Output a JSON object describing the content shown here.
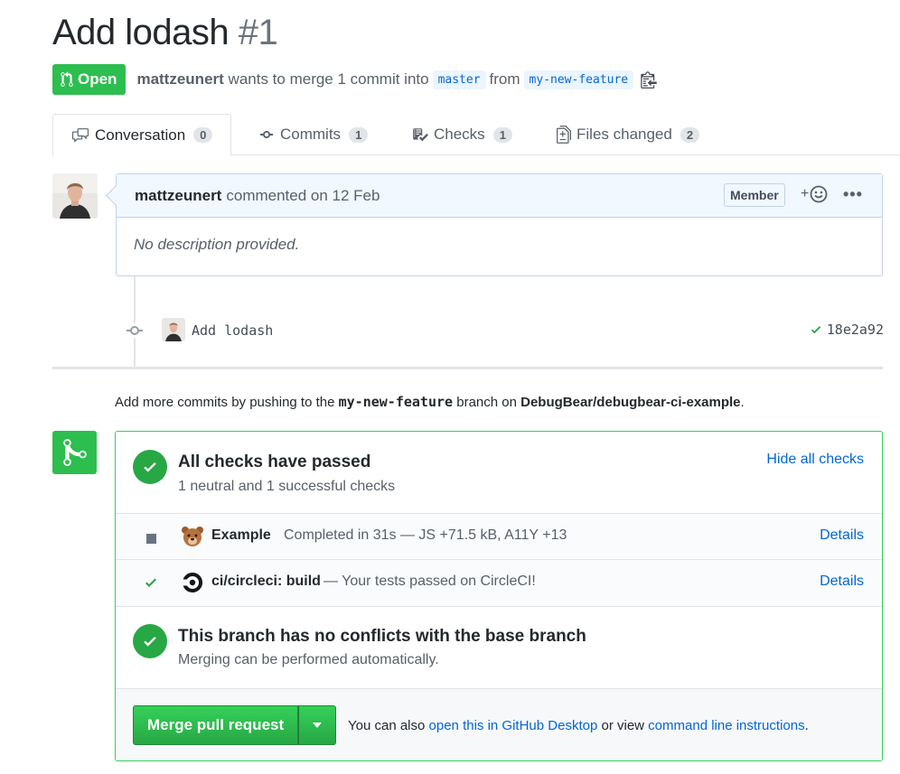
{
  "pr": {
    "title": "Add lodash",
    "number": "#1",
    "state": "Open",
    "author": "mattzeunert",
    "merge_text": "wants to merge 1 commit into",
    "base_branch": "master",
    "from_text": "from",
    "head_branch": "my-new-feature"
  },
  "tabs": [
    {
      "label": "Conversation",
      "count": "0",
      "icon": "comment-discussion-icon",
      "active": true
    },
    {
      "label": "Commits",
      "count": "1",
      "icon": "git-commit-icon"
    },
    {
      "label": "Checks",
      "count": "1",
      "icon": "checklist-icon"
    },
    {
      "label": "Files changed",
      "count": "2",
      "icon": "file-diff-icon"
    }
  ],
  "comment": {
    "author": "mattzeunert",
    "when": "commented on 12 Feb",
    "badge": "Member",
    "reaction_plus": "+",
    "more": "•••",
    "body": "No description provided."
  },
  "commit": {
    "message": "Add lodash",
    "sha": "18e2a92"
  },
  "push_note": {
    "prefix": "Add more commits by pushing to the",
    "branch": "my-new-feature",
    "middle": "branch on",
    "repo": "DebugBear/debugbear-ci-example",
    "suffix": "."
  },
  "checks": {
    "title": "All checks have passed",
    "subtitle": "1 neutral and 1 successful checks",
    "hide_label": "Hide all checks",
    "items": [
      {
        "name": "Example",
        "description": "Completed in 31s — JS +71.5 kB, A11Y +13",
        "details": "Details",
        "status": "neutral",
        "icon": "bear-icon"
      },
      {
        "name": "ci/circleci: build",
        "description": "— Your tests passed on CircleCI!",
        "details": "Details",
        "status": "success",
        "icon": "circleci-icon"
      }
    ]
  },
  "conflicts": {
    "title": "This branch has no conflicts with the base branch",
    "subtitle": "Merging can be performed automatically."
  },
  "merge": {
    "button_label": "Merge pull request",
    "hint_prefix": "You can also",
    "desktop_link": "open this in GitHub Desktop",
    "hint_middle": "or view",
    "cli_link": "command line instructions",
    "hint_suffix": "."
  },
  "colors": {
    "success": "#2cbe4e",
    "link": "#0366d6",
    "text": "#24292e",
    "muted": "#586069"
  }
}
